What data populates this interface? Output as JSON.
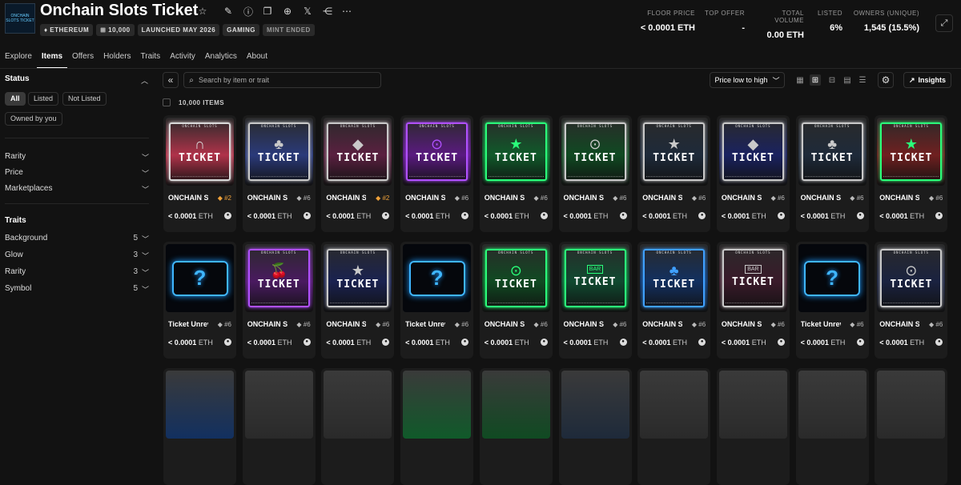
{
  "collection": {
    "title": "Onchain Slots Ticket",
    "logo_text": "ONCHAIN SLOTS TICKET",
    "tags": [
      "♦ ETHEREUM",
      "⊞ 10,000",
      "LAUNCHED MAY 2026",
      "GAMING",
      "MINT ENDED"
    ],
    "header_icons": [
      "star-icon",
      "edit-icon",
      "info-icon",
      "copy-icon",
      "globe-icon",
      "x-icon",
      "share-icon",
      "more-icon"
    ]
  },
  "stats": [
    {
      "label": "FLOOR PRICE",
      "value": "< 0.0001 ETH"
    },
    {
      "label": "TOP OFFER",
      "value": "-"
    },
    {
      "label": "TOTAL VOLUME",
      "value": "0.00 ETH"
    },
    {
      "label": "LISTED",
      "value": "6%"
    },
    {
      "label": "OWNERS (UNIQUE)",
      "value": "1,545 (15.5%)"
    }
  ],
  "tabs": [
    "Explore",
    "Items",
    "Offers",
    "Holders",
    "Traits",
    "Activity",
    "Analytics",
    "About"
  ],
  "active_tab": "Items",
  "sidebar": {
    "status_title": "Status",
    "status_pills": [
      "All",
      "Listed",
      "Not Listed",
      "Owned by you"
    ],
    "filters": [
      "Rarity",
      "Price",
      "Marketplaces"
    ],
    "traits_title": "Traits",
    "traits": [
      {
        "name": "Background",
        "count": "5"
      },
      {
        "name": "Glow",
        "count": "3"
      },
      {
        "name": "Rarity",
        "count": "3"
      },
      {
        "name": "Symbol",
        "count": "5"
      }
    ]
  },
  "toolbar": {
    "search_placeholder": "Search by item or trait",
    "sort_label": "Price low to high",
    "insights_label": "Insights"
  },
  "items_count": "10,000 ITEMS",
  "ticket_header": "ONCHAIN SLOTS",
  "ticket_word": "TICKET",
  "price_value": "< 0.0001",
  "price_currency": "ETH",
  "items": [
    {
      "name": "ONCHAIN SLOTS TICKET",
      "rank": "#2",
      "gold": true,
      "color": "#b0334a",
      "frame": "#d9d9d9",
      "symbol": "∩",
      "revealed": true
    },
    {
      "name": "ONCHAIN SLOTS TICKET",
      "rank": "#6",
      "gold": false,
      "color": "#2a3a7a",
      "frame": "#c9c9c9",
      "symbol": "♣",
      "revealed": true
    },
    {
      "name": "ONCHAIN SLOTS TICKET",
      "rank": "#2",
      "gold": true,
      "color": "#5a2040",
      "frame": "#c9c9c9",
      "symbol": "◆",
      "revealed": true
    },
    {
      "name": "ONCHAIN SLOTS TICKET",
      "rank": "#6",
      "gold": false,
      "color": "#5a1a80",
      "frame": "#b050ff",
      "symbol": "⊙",
      "revealed": true
    },
    {
      "name": "ONCHAIN SLOTS TICKET",
      "rank": "#6",
      "gold": false,
      "color": "#105a2a",
      "frame": "#2aff7a",
      "symbol": "★",
      "revealed": true
    },
    {
      "name": "ONCHAIN SLOTS TICKET",
      "rank": "#6",
      "gold": false,
      "color": "#104a22",
      "frame": "#c9c9c9",
      "symbol": "⊙",
      "revealed": true
    },
    {
      "name": "ONCHAIN SLOTS TICKET",
      "rank": "#6",
      "gold": false,
      "color": "#1e2a3a",
      "frame": "#c9c9c9",
      "symbol": "★",
      "revealed": true
    },
    {
      "name": "ONCHAIN SLOTS TICKET",
      "rank": "#6",
      "gold": false,
      "color": "#1a2260",
      "frame": "#c9c9c9",
      "symbol": "◆",
      "revealed": true
    },
    {
      "name": "ONCHAIN SLOTS TICKET",
      "rank": "#6",
      "gold": false,
      "color": "#1e2a3a",
      "frame": "#c9c9c9",
      "symbol": "♣",
      "revealed": true
    },
    {
      "name": "ONCHAIN SLOTS TICKET",
      "rank": "#6",
      "gold": false,
      "color": "#702020",
      "frame": "#2aff7a",
      "symbol": "★",
      "revealed": true
    },
    {
      "name": "Ticket Unrevealed",
      "rank": "#6",
      "gold": false,
      "color": "#05070c",
      "frame": "#3fb6ff",
      "symbol": "?",
      "revealed": false
    },
    {
      "name": "ONCHAIN SLOTS TICKET",
      "rank": "#6",
      "gold": false,
      "color": "#4a1a60",
      "frame": "#b050ff",
      "symbol": "🍒",
      "revealed": true
    },
    {
      "name": "ONCHAIN SLOTS TICKET",
      "rank": "#6",
      "gold": false,
      "color": "#1a2250",
      "frame": "#c9c9c9",
      "symbol": "★",
      "revealed": true
    },
    {
      "name": "Ticket Unrevealed",
      "rank": "#6",
      "gold": false,
      "color": "#05070c",
      "frame": "#3fb6ff",
      "symbol": "?",
      "revealed": false
    },
    {
      "name": "ONCHAIN SLOTS TICKET",
      "rank": "#6",
      "gold": false,
      "color": "#104a22",
      "frame": "#2aff7a",
      "symbol": "⊙",
      "revealed": true
    },
    {
      "name": "ONCHAIN SLOTS TICKET",
      "rank": "#6",
      "gold": false,
      "color": "#104a30",
      "frame": "#2aff7a",
      "symbol": "BAR",
      "revealed": true
    },
    {
      "name": "ONCHAIN SLOTS TICKET",
      "rank": "#6",
      "gold": false,
      "color": "#123060",
      "frame": "#3fa0ff",
      "symbol": "♣",
      "revealed": true
    },
    {
      "name": "ONCHAIN SLOTS TICKET",
      "rank": "#6",
      "gold": false,
      "color": "#3a1a2a",
      "frame": "#c9c9c9",
      "symbol": "BAR",
      "revealed": true
    },
    {
      "name": "Ticket Unrevealed",
      "rank": "#6",
      "gold": false,
      "color": "#05070c",
      "frame": "#3fb6ff",
      "symbol": "?",
      "revealed": false
    },
    {
      "name": "ONCHAIN SLOTS TICKET",
      "rank": "#6",
      "gold": false,
      "color": "#1a2240",
      "frame": "#c9c9c9",
      "symbol": "⊙",
      "revealed": true
    }
  ],
  "third_row_colors": [
    "#123060",
    "#2a2a2a",
    "#2a2a2a",
    "#105a2a",
    "#104a22",
    "#1e2a3a",
    "#2a2a2a",
    "#2a2a2a",
    "#2a2a2a",
    "#2a2a2a"
  ]
}
